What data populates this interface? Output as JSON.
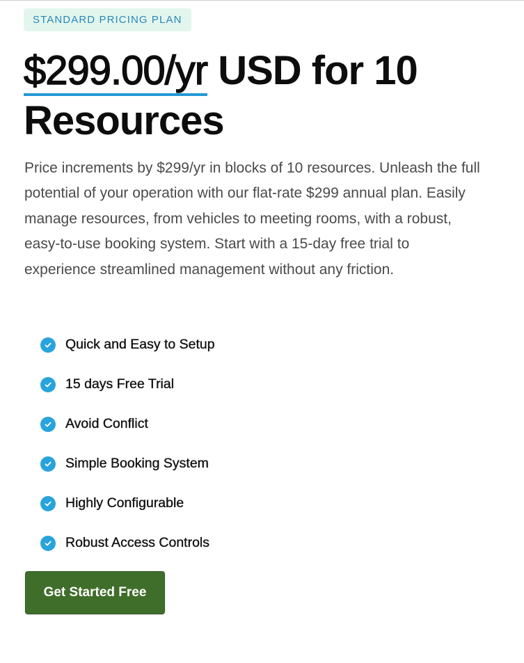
{
  "badge": "STANDARD PRICING PLAN",
  "headline": {
    "price": "$299.00/yr",
    "rest": " USD for 10 Resources"
  },
  "description": "Price increments by $299/yr in blocks of 10 resources. Unleash the full potential of your operation with our flat-rate $299 annual plan. Easily manage resources, from vehicles to meeting rooms, with a robust, easy-to-use booking system. Start with a 15-day free trial to experience streamlined management without any friction.",
  "features": [
    {
      "label": "Quick and Easy to Setup",
      "icon": "check-circle-icon"
    },
    {
      "label": "15 days Free Trial",
      "icon": "check-circle-icon"
    },
    {
      "label": "Avoid Conflict",
      "icon": "check-circle-icon"
    },
    {
      "label": "Simple Booking System",
      "icon": "check-circle-icon"
    },
    {
      "label": "Highly Configurable",
      "icon": "check-circle-icon"
    },
    {
      "label": "Robust Access Controls",
      "icon": "check-circle-icon"
    }
  ],
  "cta": {
    "label": "Get Started Free"
  },
  "colors": {
    "accent": "#29a3dc",
    "badge_bg": "#e2f6ee",
    "badge_text": "#2a86b8",
    "cta_bg": "#3f6e2a",
    "price_underline": "#2598d6"
  }
}
